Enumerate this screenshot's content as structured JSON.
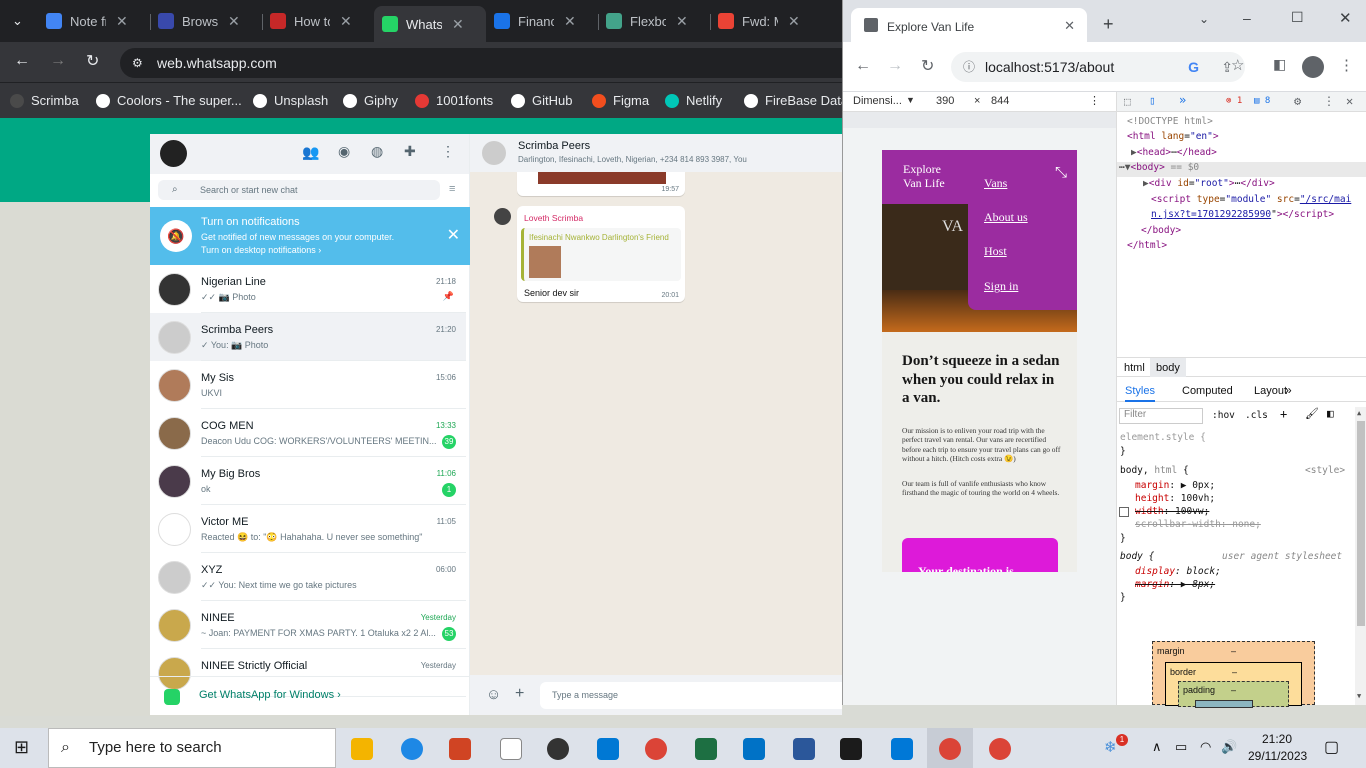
{
  "browser": {
    "tabs": [
      {
        "label": "Note fr",
        "color": "#4285f4"
      },
      {
        "label": "Browse",
        "color": "#3949ab"
      },
      {
        "label": "How to",
        "color": "#c62828"
      },
      {
        "label": "WhatsA",
        "color": "#25d366"
      },
      {
        "label": "Finance",
        "color": "#1a73e8"
      },
      {
        "label": "Flexbox",
        "color": "#43a38a"
      },
      {
        "label": "Fwd: M",
        "color": "#ea4335"
      }
    ],
    "url": "web.whatsapp.com",
    "bookmarks": [
      "Scrimba",
      "Coolors - The super...",
      "Unsplash",
      "Giphy",
      "1001fonts",
      "GitHub",
      "Figma",
      "Netlify",
      "FireBase Data"
    ]
  },
  "whatsapp": {
    "search_placeholder": "Search or start new chat",
    "notification": {
      "title": "Turn on notifications",
      "body": "Get notified of new messages on your computer.",
      "link": "Turn on desktop notifications ›"
    },
    "chats": [
      {
        "name": "Nigerian Line",
        "preview": "✓✓ 📷 Photo",
        "time": "21:18",
        "badge": "",
        "color": "#333"
      },
      {
        "name": "Scrimba Peers",
        "preview": "✓ You: 📷 Photo",
        "time": "21:20",
        "badge": "",
        "color": "#ccc"
      },
      {
        "name": "My Sis",
        "preview": "UKVI",
        "time": "15:06",
        "badge": "",
        "color": "#b07b5a"
      },
      {
        "name": "COG MEN",
        "preview": "Deacon Udu COG: WORKERS'/VOLUNTEERS' MEETIN...",
        "time": "13:33",
        "badge": "39",
        "color": "#8a6a4a"
      },
      {
        "name": "My Big Bros",
        "preview": "ok",
        "time": "11:06",
        "badge": "1",
        "color": "#4a3a4a"
      },
      {
        "name": "Victor ME",
        "preview": "Reacted 😆 to: \"😳 Hahahaha. U never see something\"",
        "time": "11:05",
        "badge": "",
        "color": "#fff"
      },
      {
        "name": "XYZ",
        "preview": "✓✓ You: Next time we go take pictures",
        "time": "06:00",
        "badge": "",
        "color": "#ccc"
      },
      {
        "name": "NINEE",
        "preview": "~ Joan: PAYMENT FOR XMAS PARTY. 1 Otaluka x2 2 Al...",
        "time": "Yesterday",
        "badge": "53",
        "color": "#c9a84c"
      },
      {
        "name": "NINEE Strictly Official",
        "preview": "",
        "time": "Yesterday",
        "badge": "",
        "color": "#c9a84c"
      }
    ],
    "footer": "Get WhatsApp for Windows ›",
    "conversation": {
      "name": "Scrimba Peers",
      "members": "Darlington, Ifesinachi, Loveth, Nigerian, +234 814 893 3987, You",
      "first_time": "19:57",
      "sender": "Loveth Scrimba",
      "quoted": "Ifesinachi Nwankwo Darlington's Friend",
      "message": "Senior dev sir",
      "message_time": "20:01",
      "compose_placeholder": "Type a message"
    }
  },
  "devtools": {
    "page_title": "Explore Van Life",
    "url": "localhost:5173/about",
    "device": "Dimensi...",
    "width": "390",
    "height": "844",
    "errors": "1",
    "messages": "8",
    "app": {
      "brand": "Explore Van Life",
      "nav": [
        "Vans",
        "About us",
        "Host",
        "Sign in"
      ],
      "heading": "Don’t squeeze in a sedan when you could relax in a van.",
      "p1": "Our mission is to enliven your road trip with the perfect travel van rental. Our vans are recertified before each trip to ensure your travel plans can go off without a hitch. (Hitch costs extra 😉)",
      "p2": "Our team is full of vanlife enthusiasts who know firsthand the magic of touring the world on 4 wheels.",
      "cta": "Your destination is"
    },
    "tabs": [
      "Styles",
      "Computed",
      "Layout"
    ],
    "crumbs": [
      "html",
      "body"
    ],
    "filter_placeholder": "Filter",
    "hov": ":hov",
    "cls": ".cls",
    "box": {
      "margin": "margin",
      "border": "border",
      "padding": "padding",
      "dash": "–"
    }
  },
  "taskbar": {
    "search": "Type here to search",
    "time": "21:20",
    "date": "29/11/2023",
    "badge": "1"
  }
}
